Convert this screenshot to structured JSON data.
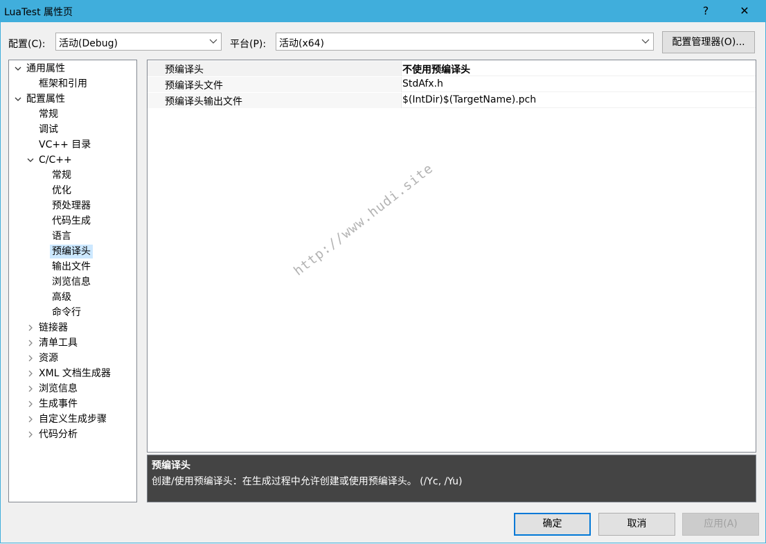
{
  "window": {
    "title": "LuaTest 属性页",
    "help_label": "?",
    "close_label": "✕"
  },
  "toolbar": {
    "config_label": "配置(C):",
    "config_value": "活动(Debug)",
    "platform_label": "平台(P):",
    "platform_value": "活动(x64)",
    "config_manager_label": "配置管理器(O)..."
  },
  "tree": [
    {
      "label": "通用属性",
      "level": 0,
      "state": "expanded"
    },
    {
      "label": "框架和引用",
      "level": 1,
      "state": "none"
    },
    {
      "label": "配置属性",
      "level": 0,
      "state": "expanded"
    },
    {
      "label": "常规",
      "level": 1,
      "state": "none"
    },
    {
      "label": "调试",
      "level": 1,
      "state": "none"
    },
    {
      "label": "VC++ 目录",
      "level": 1,
      "state": "none"
    },
    {
      "label": "C/C++",
      "level": 1,
      "state": "expanded"
    },
    {
      "label": "常规",
      "level": 2,
      "state": "none"
    },
    {
      "label": "优化",
      "level": 2,
      "state": "none"
    },
    {
      "label": "预处理器",
      "level": 2,
      "state": "none"
    },
    {
      "label": "代码生成",
      "level": 2,
      "state": "none"
    },
    {
      "label": "语言",
      "level": 2,
      "state": "none"
    },
    {
      "label": "预编译头",
      "level": 2,
      "state": "selected"
    },
    {
      "label": "输出文件",
      "level": 2,
      "state": "none"
    },
    {
      "label": "浏览信息",
      "level": 2,
      "state": "none"
    },
    {
      "label": "高级",
      "level": 2,
      "state": "none"
    },
    {
      "label": "命令行",
      "level": 2,
      "state": "none"
    },
    {
      "label": "链接器",
      "level": 1,
      "state": "collapsed"
    },
    {
      "label": "清单工具",
      "level": 1,
      "state": "collapsed"
    },
    {
      "label": "资源",
      "level": 1,
      "state": "collapsed"
    },
    {
      "label": "XML 文档生成器",
      "level": 1,
      "state": "collapsed"
    },
    {
      "label": "浏览信息",
      "level": 1,
      "state": "collapsed"
    },
    {
      "label": "生成事件",
      "level": 1,
      "state": "collapsed"
    },
    {
      "label": "自定义生成步骤",
      "level": 1,
      "state": "collapsed"
    },
    {
      "label": "代码分析",
      "level": 1,
      "state": "collapsed"
    }
  ],
  "properties": [
    {
      "name": "预编译头",
      "value": "不使用预编译头",
      "bold": true
    },
    {
      "name": "预编译头文件",
      "value": "StdAfx.h",
      "bold": false
    },
    {
      "name": "预编译头输出文件",
      "value": "$(IntDir)$(TargetName).pch",
      "bold": false
    }
  ],
  "description": {
    "title": "预编译头",
    "text": "创建/使用预编译头：在生成过程中允许创建或使用预编译头。     (/Yc, /Yu)"
  },
  "buttons": {
    "ok": "确定",
    "cancel": "取消",
    "apply": "应用(A)"
  },
  "watermark": "http://www.hudi.site",
  "colors": {
    "titlebar": "#40aedc",
    "selection": "#cce8ff",
    "primary_border": "#0078d7",
    "desc_bg": "#444444"
  }
}
